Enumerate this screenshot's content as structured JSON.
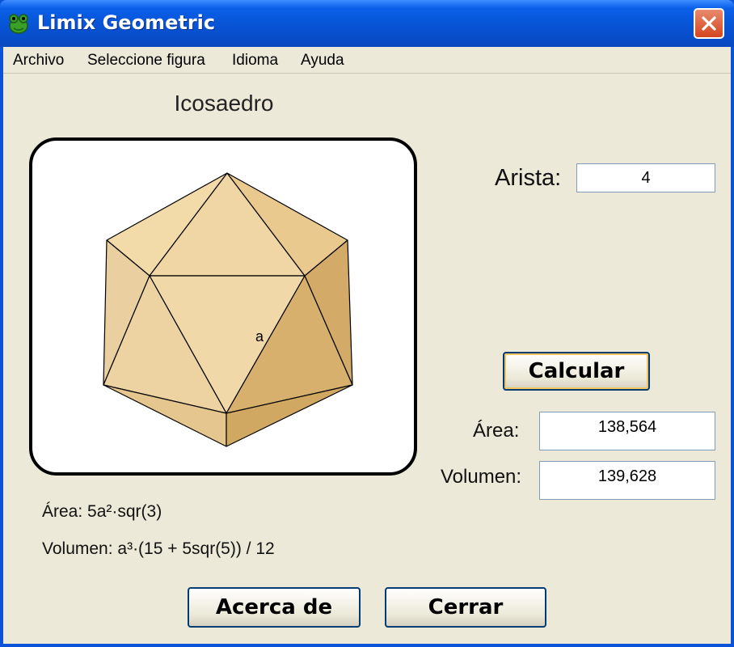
{
  "window": {
    "title": "Limix Geometric",
    "icon": "frog-icon",
    "close_glyph": "✕"
  },
  "menu": [
    {
      "label": "Archivo"
    },
    {
      "label": "Seleccione figura"
    },
    {
      "label": "Idioma"
    },
    {
      "label": "Ayuda"
    }
  ],
  "figure": {
    "name": "Icosaedro",
    "edge_label": "a"
  },
  "inputs": {
    "arista_label": "Arista:",
    "arista_value": "4"
  },
  "buttons": {
    "calcular": "Calcular",
    "acerca": "Acerca de",
    "cerrar": "Cerrar"
  },
  "results": {
    "area_label": "Área:",
    "area_value": "138,564",
    "volumen_label": "Volumen:",
    "volumen_value": "139,628"
  },
  "formulas": {
    "area": "Área: 5a²·sqr(3)",
    "volumen": "Volumen: a³·(15 + 5sqr(5)) / 12"
  },
  "colors": {
    "titlebar_blue": "#0752d2",
    "face_light": "#f0d6a4",
    "face_mid": "#e3c084",
    "face_dark": "#cfa562"
  }
}
